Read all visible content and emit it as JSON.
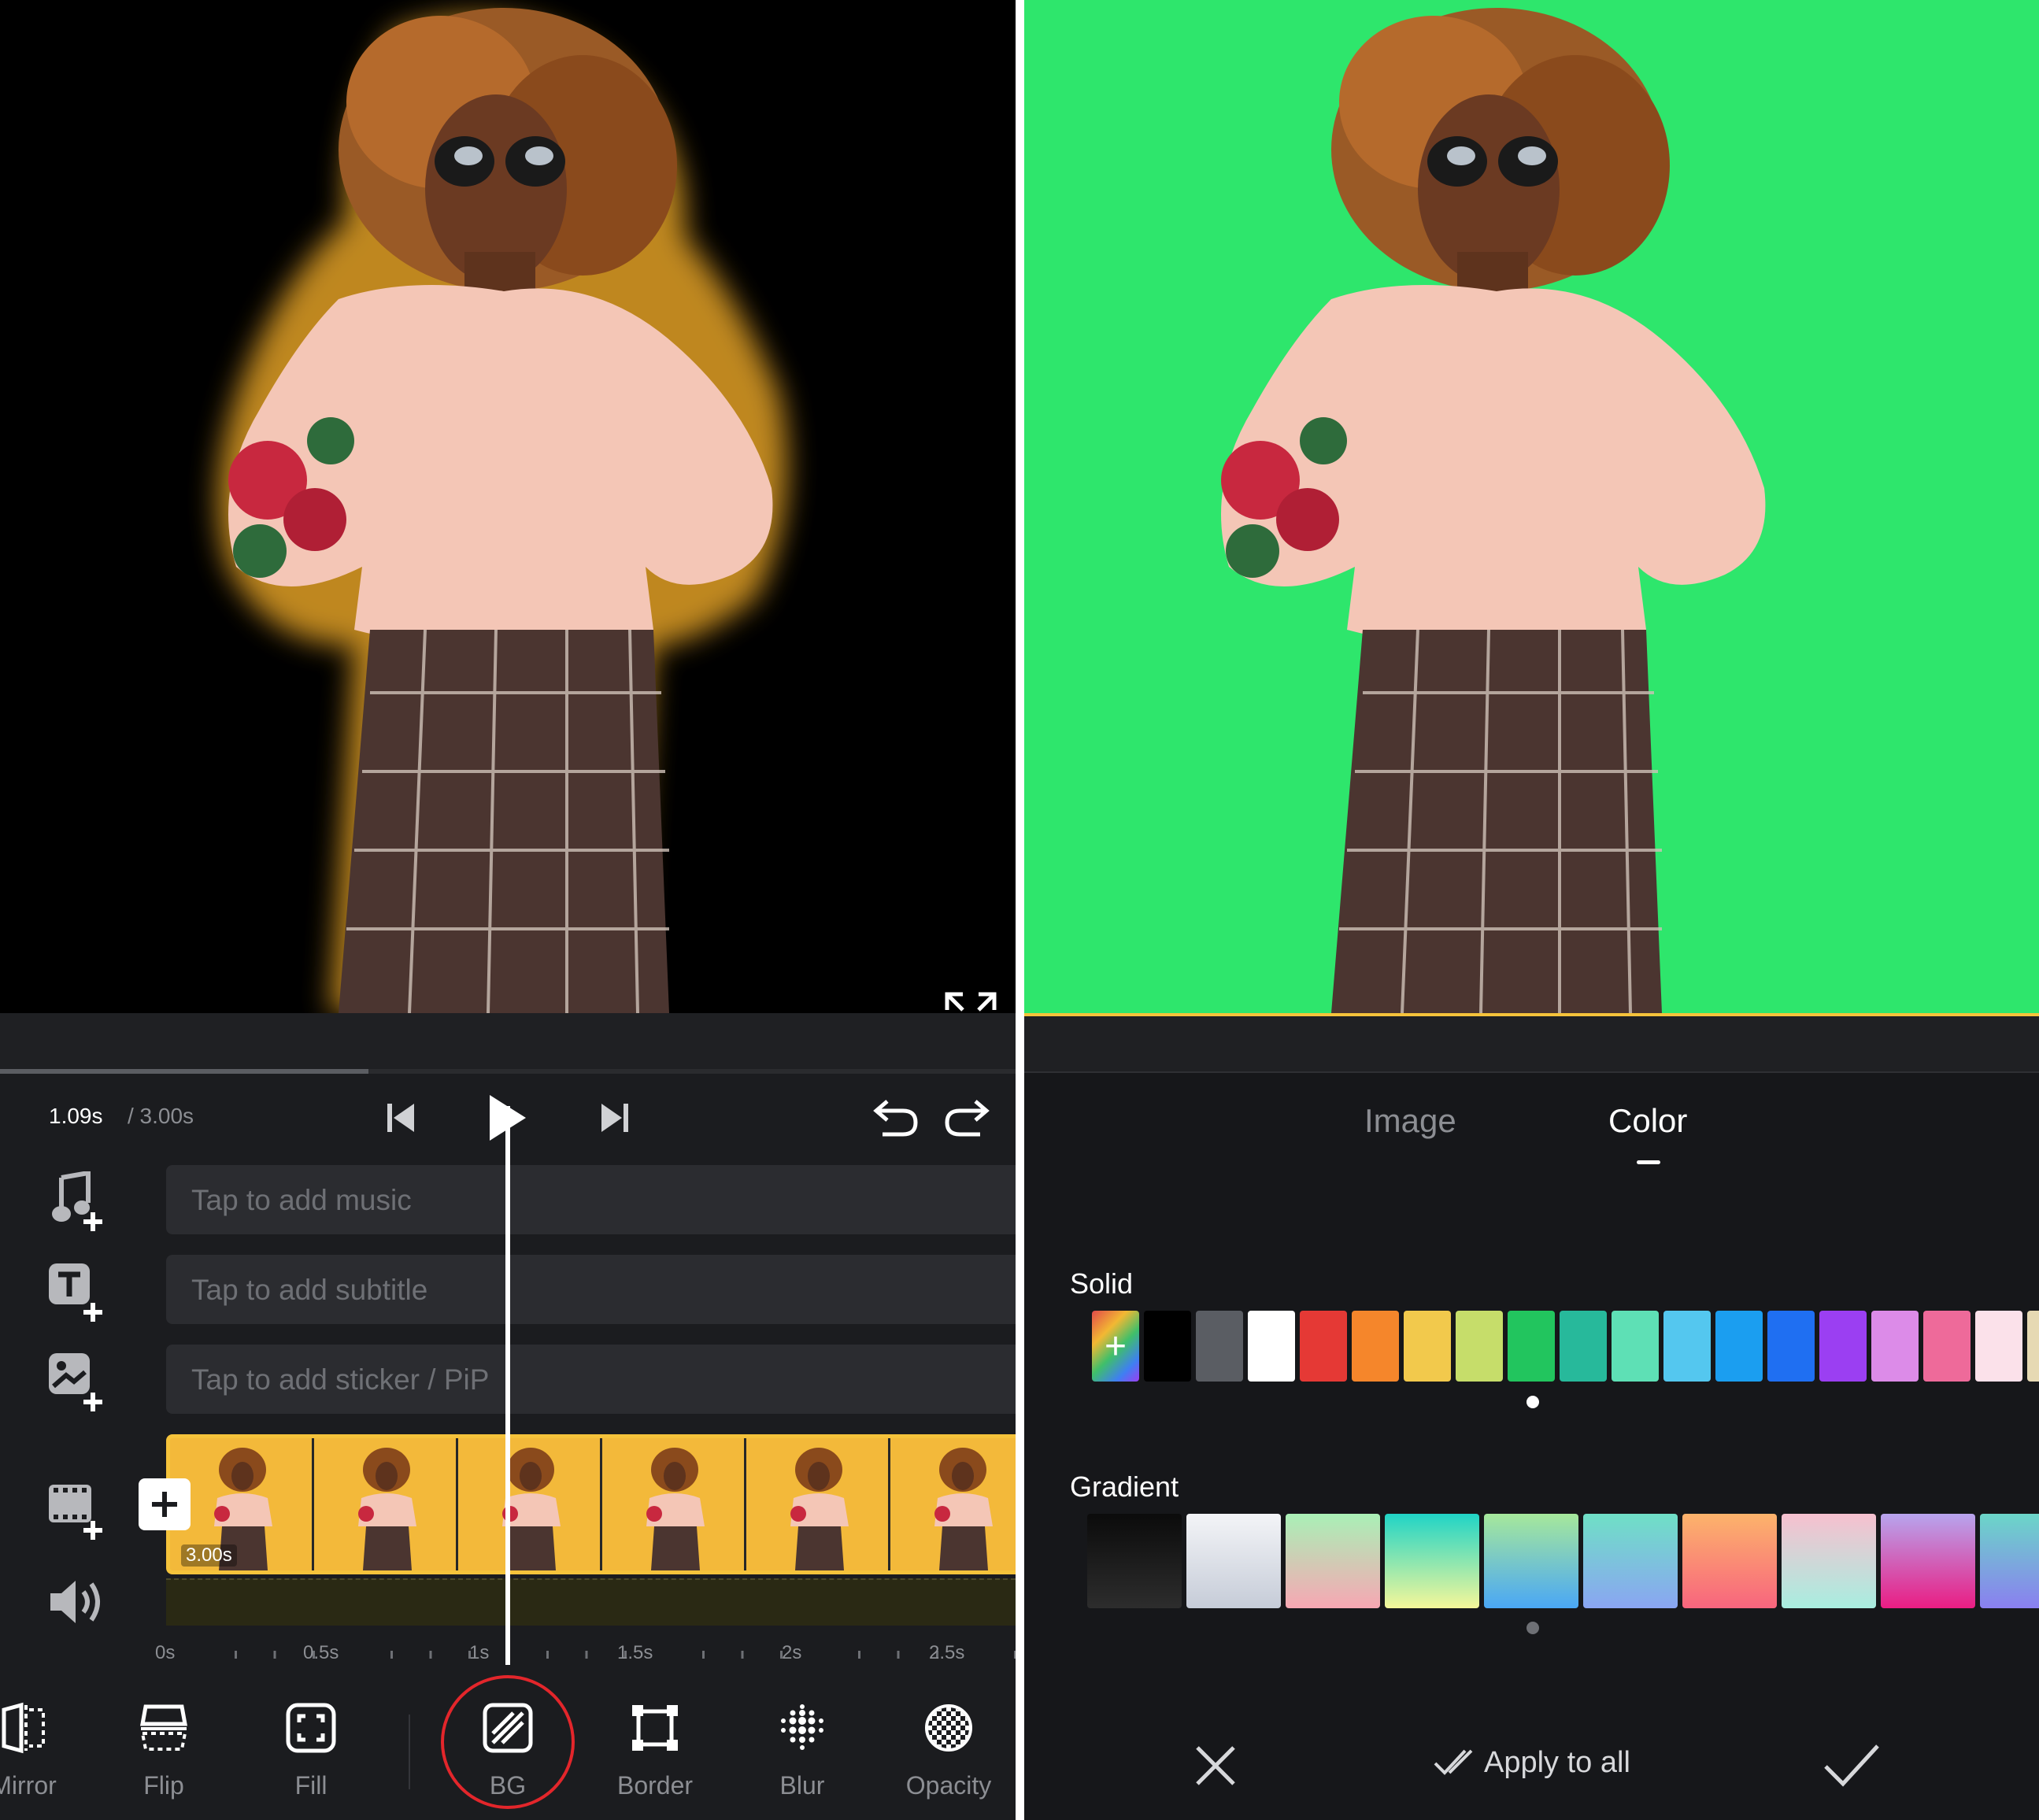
{
  "left_panel": {
    "time": {
      "current": "1.09s",
      "separator_total": "/ 3.00s"
    },
    "tracks": {
      "music_placeholder": "Tap to add music",
      "subtitle_placeholder": "Tap to add subtitle",
      "sticker_placeholder": "Tap to add sticker / PiP"
    },
    "clip": {
      "duration": "3.00s",
      "frame_count": 6
    },
    "progress_fraction": 0.363,
    "ruler": [
      "0s",
      "0.5s",
      "1s",
      "1.5s",
      "2s",
      "2.5s"
    ],
    "toolbar": [
      {
        "id": "mirror",
        "label": "Mirror",
        "icon": "mirror-icon"
      },
      {
        "id": "flip",
        "label": "Flip",
        "icon": "flip-icon"
      },
      {
        "id": "fill",
        "label": "Fill",
        "icon": "fill-icon"
      },
      {
        "id": "bg",
        "label": "BG",
        "icon": "bg-icon",
        "selected": true
      },
      {
        "id": "border",
        "label": "Border",
        "icon": "border-icon"
      },
      {
        "id": "blur",
        "label": "Blur",
        "icon": "blur-icon"
      },
      {
        "id": "opacity",
        "label": "Opacity",
        "icon": "opacity-icon"
      }
    ],
    "colors": {
      "highlight_ring": "#e3262b",
      "clip_border": "#f5c33b",
      "preview_bg": "#000000"
    }
  },
  "right_panel": {
    "tabs": [
      {
        "label": "Image",
        "active": false
      },
      {
        "label": "Color",
        "active": true
      }
    ],
    "solid": {
      "title": "Solid",
      "swatches": [
        "#000000",
        "#5a5d63",
        "#ffffff",
        "#e53935",
        "#f5862b",
        "#f2c94c",
        "#c6dd6a",
        "#22c55e",
        "#27b99b",
        "#5ee0b5",
        "#54c7ef",
        "#1b9ef0",
        "#1f6ff2",
        "#9b3ff2",
        "#dc8be8",
        "#ee6a9a",
        "#fbe1ea",
        "#e6d9b3"
      ],
      "selected_index": 7
    },
    "gradient": {
      "title": "Gradient",
      "swatches": [
        [
          "#0b0b0b",
          "#2d2d2d"
        ],
        [
          "#f3f4f7",
          "#c6ccd8"
        ],
        [
          "#a9f0b6",
          "#f7a7b3"
        ],
        [
          "#20d4c6",
          "#f5f79a"
        ],
        [
          "#a6e89b",
          "#4aa7f5"
        ],
        [
          "#6fe0c6",
          "#8aa5f2"
        ],
        [
          "#fcb36b",
          "#f8657e"
        ],
        [
          "#f7c0cf",
          "#a8eee0"
        ],
        [
          "#b7a5ee",
          "#ea1d83"
        ],
        [
          "#6bd6c8",
          "#8a7ff0"
        ]
      ]
    },
    "actions": {
      "apply_all": "Apply to all"
    },
    "colors": {
      "preview_bg": "#2ee66c"
    }
  }
}
